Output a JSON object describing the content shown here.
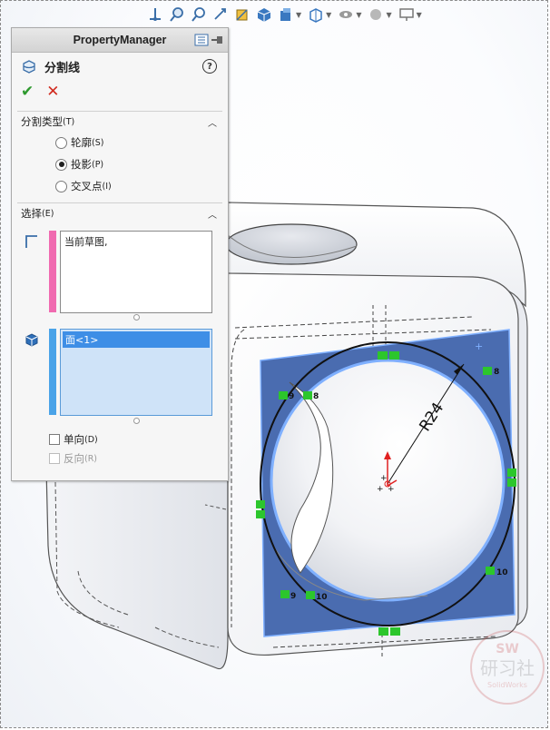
{
  "pm": {
    "header_title": "PropertyManager",
    "feature_title": "分割线",
    "help_glyph": "?",
    "ok_glyph": "✔",
    "cancel_glyph": "✕",
    "split_type": {
      "title": "分割类型",
      "key": "(T)",
      "options": [
        {
          "label": "轮廓",
          "key": "(S)",
          "selected": false
        },
        {
          "label": "投影",
          "key": "(P)",
          "selected": true
        },
        {
          "label": "交叉点",
          "key": "(I)",
          "selected": false
        }
      ]
    },
    "selection": {
      "title": "选择",
      "key": "(E)",
      "sketch_item": "当前草图,",
      "face_item": "面<1>"
    },
    "single_dir": {
      "label": "单向",
      "key": "(D)",
      "checked": false
    },
    "reverse": {
      "label": "反向",
      "key": "(R)",
      "checked": false,
      "disabled": true
    }
  },
  "viewport": {
    "dimension_label": "R24",
    "constraint_labels": [
      "8",
      "9",
      "8",
      "10",
      "9",
      "10"
    ],
    "face_color": "#4a6cb0",
    "highlight_color": "#7fb0ff"
  },
  "watermark": {
    "badge": "SW",
    "text": "研习社",
    "sub": "SolidWorks"
  },
  "colors": {
    "accent_green": "#2f9a2f",
    "cancel_red": "#d12b1f",
    "selection_blue": "#cfe3f8",
    "sketch_pink": "#f06ab0"
  }
}
